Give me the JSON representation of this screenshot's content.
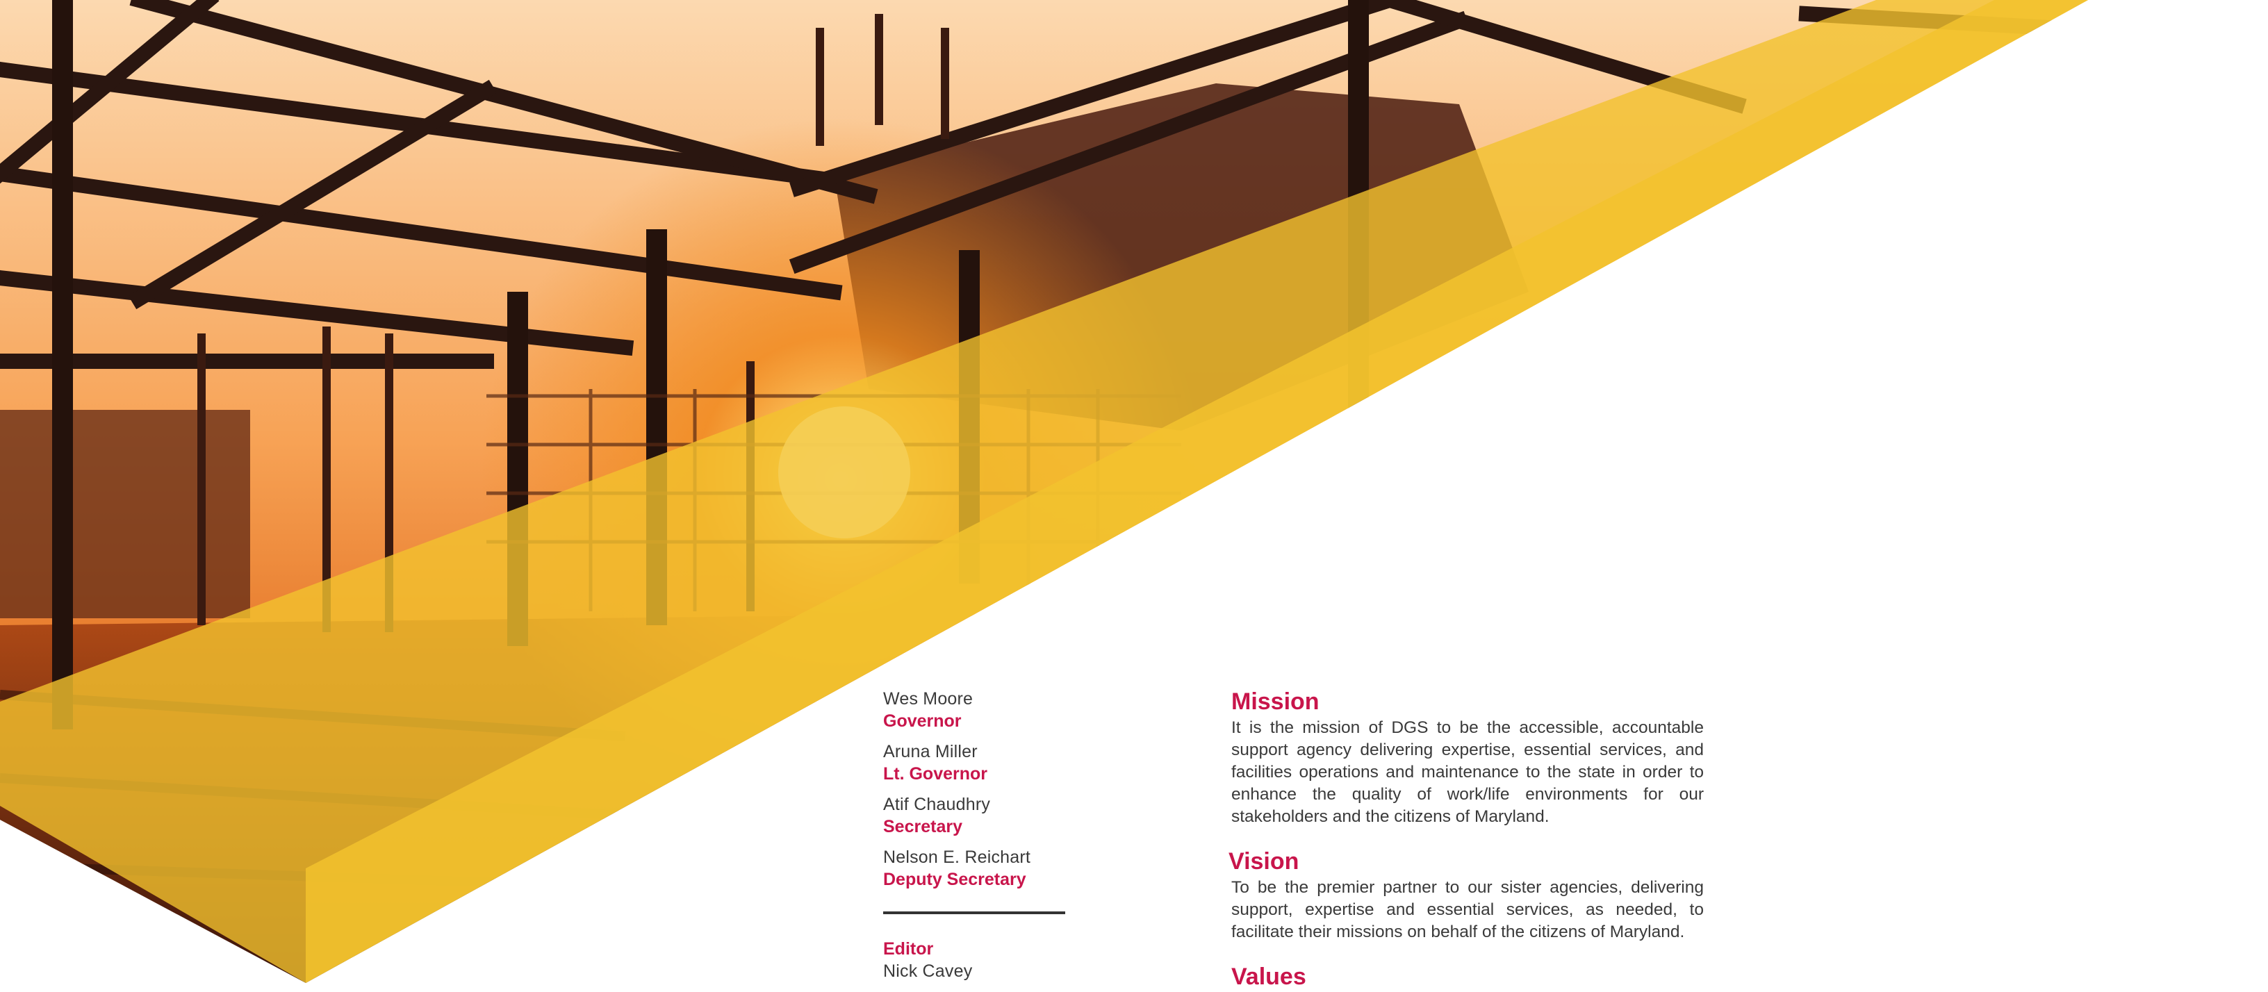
{
  "leadership": [
    {
      "name": "Wes Moore",
      "title": "Governor"
    },
    {
      "name": "Aruna Miller",
      "title": "Lt. Governor"
    },
    {
      "name": "Atif Chaudhry",
      "title": "Secretary"
    },
    {
      "name": "Nelson E. Reichart",
      "title": "Deputy Secretary"
    }
  ],
  "editor": {
    "label": "Editor",
    "name": "Nick Cavey"
  },
  "mission": {
    "heading": "Mission",
    "text": "It is the mission of DGS to be the accessible, accountable support agency delivering expertise, essential services, and facilities operations and maintenance to the state in order to enhance the quality of work/life environments for our stakeholders and the citizens of Maryland."
  },
  "vision": {
    "heading": "Vision",
    "text": "To be the premier partner to our sister agencies, delivering support, expertise and essential services, as needed, to facilitate their missions on behalf of the citizens of Maryland."
  },
  "values": {
    "heading": "Values"
  },
  "colors": {
    "accent": "#c8154b",
    "gold": "#f2c22e",
    "text": "#3a3a3a"
  }
}
